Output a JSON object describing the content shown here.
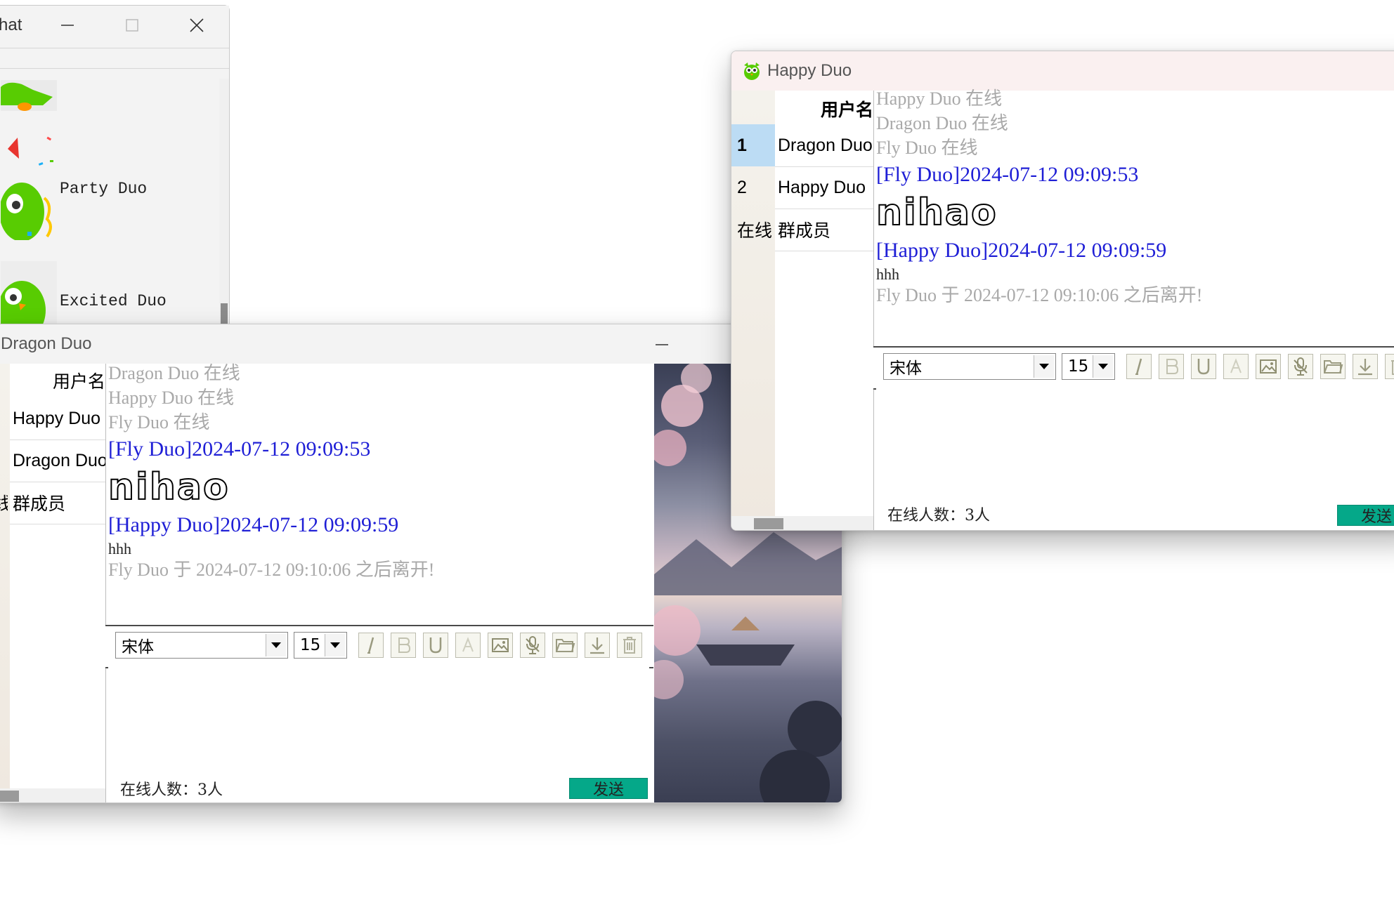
{
  "contact_window": {
    "title": "hat",
    "contacts": [
      {
        "name": ""
      },
      {
        "name": "Party Duo"
      },
      {
        "name": "Excited Duo"
      }
    ]
  },
  "back_window": {
    "title": "Dragon Duo",
    "members": {
      "header": "用户名",
      "rows": [
        {
          "idx": "",
          "name": "Happy Duo"
        },
        {
          "idx": "",
          "name": "Dragon Duo"
        },
        {
          "idx": "线",
          "name": "群成员"
        }
      ]
    },
    "log": {
      "system": [
        "Dragon Duo 在线",
        "Happy Duo 在线",
        "Fly Duo 在线"
      ],
      "messages": [
        {
          "header": "[Fly Duo]2024-07-12 09:09:53",
          "body": "nihao",
          "style": "art"
        },
        {
          "header": "[Happy Duo]2024-07-12 09:09:59",
          "body": "hhh",
          "style": "plain"
        }
      ],
      "leave": "Fly Duo 于 2024-07-12 09:10:06 之后离开!"
    },
    "toolbar": {
      "font": "宋体",
      "size": "15"
    },
    "status": "在线人数：3人",
    "send_label": "发送"
  },
  "front_window": {
    "title": "Happy Duo",
    "members": {
      "header": "用户名",
      "rows": [
        {
          "idx": "1",
          "name": "Dragon Duo"
        },
        {
          "idx": "2",
          "name": "Happy Duo"
        },
        {
          "idx": "在线",
          "name": "群成员"
        }
      ]
    },
    "log": {
      "system": [
        "Happy Duo 在线",
        "Dragon Duo 在线",
        "Fly Duo 在线"
      ],
      "messages": [
        {
          "header": "[Fly Duo]2024-07-12 09:09:53",
          "body": "nihao",
          "style": "art"
        },
        {
          "header": "[Happy Duo]2024-07-12 09:09:59",
          "body": "hhh",
          "style": "plain"
        }
      ],
      "leave": "Fly Duo 于 2024-07-12 09:10:06 之后离开!"
    },
    "toolbar": {
      "font": "宋体",
      "size": "15"
    },
    "status": "在线人数：3人",
    "send_label": "发送"
  },
  "icons": {
    "toolbar": [
      "italic-icon",
      "bold-icon",
      "underline-icon",
      "font-color-icon",
      "image-icon",
      "voice-icon",
      "folder-icon",
      "download-icon",
      "trash-icon"
    ],
    "minimize": "minimize-icon",
    "maximize": "maximize-icon",
    "close": "close-icon"
  },
  "colors": {
    "send": "#05a889",
    "timestamp_blue": "#1f1fd6",
    "system_gray": "#a9a9a9",
    "selected_row": "#bcdcf4"
  }
}
